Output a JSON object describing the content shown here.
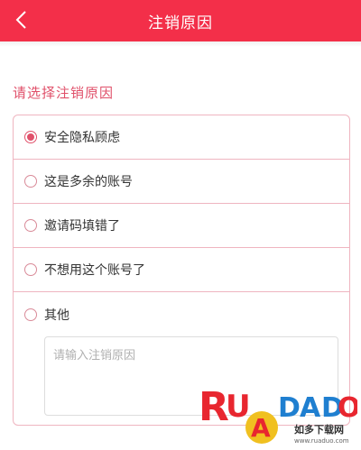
{
  "header": {
    "title": "注销原因",
    "back_icon": "chevron-left-icon",
    "background": "#f32f49"
  },
  "section": {
    "title": "请选择注销原因"
  },
  "options": [
    {
      "label": "安全隐私顾虑",
      "selected": true
    },
    {
      "label": "这是多余的账号",
      "selected": false
    },
    {
      "label": "邀请码填错了",
      "selected": false
    },
    {
      "label": "不想用这个账号了",
      "selected": false
    },
    {
      "label": "其他",
      "selected": false
    }
  ],
  "reason_input": {
    "placeholder": "请输入注销原因",
    "value": ""
  },
  "watermark": {
    "brand": "RUADADO",
    "cn_text": "如多下载网",
    "url": "www.ruaduo.com"
  },
  "colors": {
    "accent": "#e0506a",
    "border": "#efb5c0"
  }
}
